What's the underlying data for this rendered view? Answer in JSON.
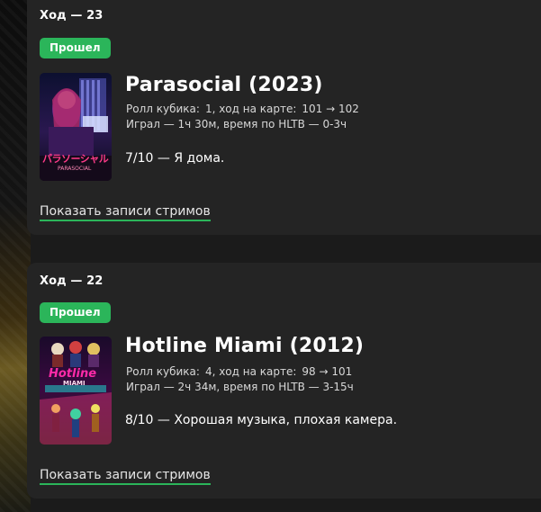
{
  "entries": [
    {
      "turn": "Ход — 23",
      "status": "Прошел",
      "title": "Parasocial (2023)",
      "roll_label": "Ролл кубика:",
      "roll_value": "1, ход на карте:",
      "map_move": "101 → 102",
      "played": "Играл — 1ч 30м, время по HLTB — 0-3ч",
      "review": "7/10 — Я дома.",
      "streams_link": "Показать записи стримов",
      "cover_text_main": "パラソーシャル",
      "cover_text_sub": "PARASOCIAL"
    },
    {
      "turn": "Ход — 22",
      "status": "Прошел",
      "title": "Hotline Miami (2012)",
      "roll_label": "Ролл кубика:",
      "roll_value": "4, ход на карте:",
      "map_move": "98 → 101",
      "played": "Играл — 2ч 34м, время по HLTB — 3-15ч",
      "review": "8/10 — Хорошая музыка, плохая камера.",
      "streams_link": "Показать записи стримов",
      "cover_text_main": "Hotline",
      "cover_text_sub": "MIAMI"
    }
  ],
  "colors": {
    "badge_green": "#2bb55a",
    "card_bg": "#242424",
    "page_bg": "#1b1b1b"
  }
}
